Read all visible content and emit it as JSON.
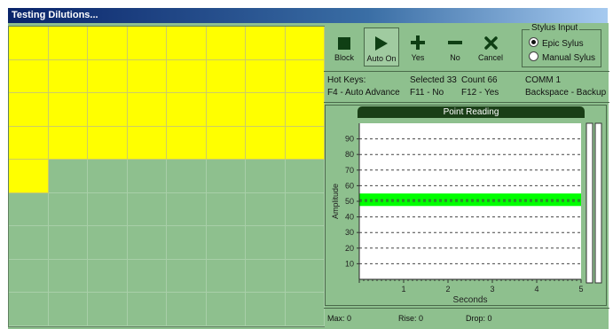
{
  "window": {
    "title": "Testing Dilutions..."
  },
  "grid": {
    "columns": 8,
    "rows": 9,
    "filled_cells": 33
  },
  "toolbar": {
    "buttons": [
      {
        "label": "Block",
        "icon": "stop-square-icon"
      },
      {
        "label": "Auto On",
        "icon": "play-triangle-icon"
      },
      {
        "label": "Yes",
        "icon": "plus-icon"
      },
      {
        "label": "No",
        "icon": "minus-icon"
      },
      {
        "label": "Cancel",
        "icon": "x-icon"
      }
    ]
  },
  "stylus": {
    "title": "Stylus Input",
    "options": [
      {
        "label": "Epic Sylus",
        "selected": true
      },
      {
        "label": "Manual Sylus",
        "selected": false
      }
    ]
  },
  "hotkeys": {
    "title": "Hot Keys:",
    "selected": "Selected 33",
    "count": "Count 66",
    "comm": "COMM 1",
    "f4": "F4 - Auto Advance",
    "f11": "F11 - No",
    "f12": "F12 - Yes",
    "backspace": "Backspace - Backup"
  },
  "chart_data": {
    "type": "line",
    "title": "Point Reading",
    "xlabel": "Seconds",
    "ylabel": "Amplitude",
    "xlim": [
      0,
      5
    ],
    "ylim": [
      0,
      100
    ],
    "x_ticks": [
      1,
      2,
      3,
      4,
      5
    ],
    "y_ticks": [
      10,
      20,
      30,
      40,
      50,
      60,
      70,
      80,
      90
    ],
    "grid": true,
    "band": {
      "low": 47,
      "high": 55,
      "color": "#00ff00"
    },
    "series": [
      {
        "x": [
          0,
          5
        ],
        "y": [
          51,
          51
        ]
      }
    ]
  },
  "stats": {
    "max": "Max: 0",
    "rise": "Rise: 0",
    "drop": "Drop: 0"
  }
}
